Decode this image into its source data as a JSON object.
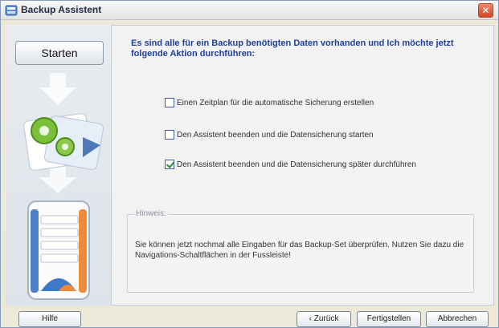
{
  "window": {
    "title": "Backup Assistent"
  },
  "sidebar": {
    "start_label": "Starten"
  },
  "main": {
    "heading": "Es sind alle für ein Backup benötigten Daten vorhanden und Ich möchte jetzt folgende Aktion durchführen:",
    "options": [
      {
        "label": "Einen Zeitplan für die automatische Sicherung erstellen",
        "checked": false
      },
      {
        "label": "Den Assistent beenden und die Datensicherung starten",
        "checked": false
      },
      {
        "label": "Den Assistent beenden und die Datensicherung später durchführen",
        "checked": true
      }
    ],
    "hint": {
      "legend": "Hinweis:",
      "text": "Sie können jetzt nochmal alle Eingaben für das Backup-Set überprüfen. Nutzen Sie dazu die Navigations-Schaltflächen in der Fussleiste!"
    }
  },
  "footer": {
    "help_label": "Hilfe",
    "back_label": "‹ Zurück",
    "finish_label": "Fertigstellen",
    "cancel_label": "Abbrechen"
  },
  "icons": {
    "title": "backup-icon",
    "close": "close-icon",
    "illustration": "gears-documents-illustration",
    "device": "backup-device-illustration"
  },
  "colors": {
    "heading": "#1f3f9a",
    "check": "#2b8a2b",
    "close": "#d2452a"
  }
}
